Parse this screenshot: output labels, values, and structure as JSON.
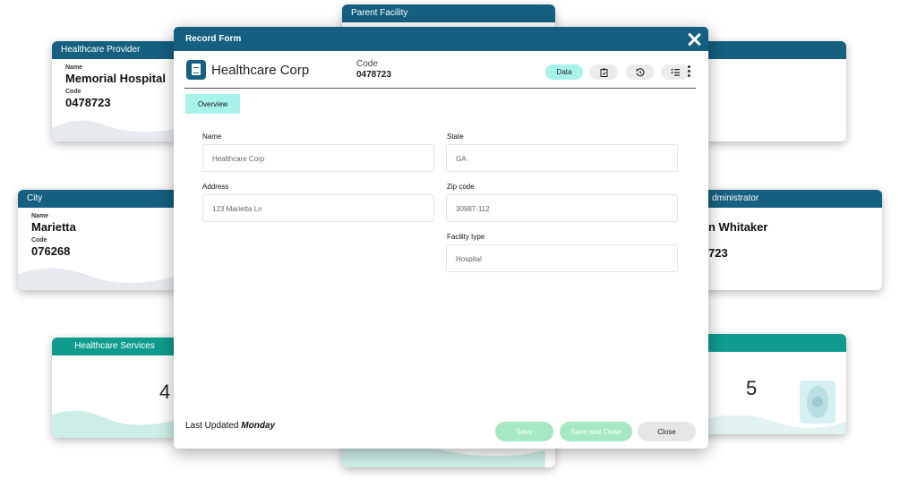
{
  "background": {
    "provider_card": {
      "header": "Healthcare Provider",
      "name_label": "Name",
      "name_value": "Memorial Hospital",
      "code_label": "Code",
      "code_value": "0478723"
    },
    "parent_card": {
      "header": "Parent Facility"
    },
    "city_card": {
      "header": "City",
      "name_label": "Name",
      "name_value": "Marietta",
      "code_label": "Code",
      "code_value": "076268"
    },
    "admin_card": {
      "header": "dministrator",
      "name_value": "n Whitaker",
      "code_value": "723"
    },
    "services_card": {
      "header": "Healthcare Services",
      "count": "4"
    },
    "right_count_card": {
      "count": "5"
    }
  },
  "modal": {
    "title": "Record Form",
    "record_name": "Healthcare Corp",
    "code_label": "Code",
    "code_value": "0478723",
    "toolbar": {
      "data_label": "Data"
    },
    "tabs": [
      {
        "label": "Overview"
      }
    ],
    "fields": {
      "name": {
        "label": "Name",
        "value": "Healthcare Corp"
      },
      "state": {
        "label": "State",
        "value": "GA"
      },
      "address": {
        "label": "Address",
        "value": "123 Marietta Ln"
      },
      "zip": {
        "label": "Zip code",
        "value": "30987-112"
      },
      "facility_type": {
        "label": "Facility type",
        "value": "Hospital"
      }
    },
    "footer": {
      "updated_prefix": "Last Updated",
      "updated_value": "Monday",
      "save_label": "Save",
      "save_close_label": "Save and Close",
      "close_label": "Close"
    }
  },
  "colors": {
    "header": "#155f80",
    "teal": "#0f9c8f",
    "accent": "#a8f2ec",
    "save": "#a6e8c3"
  }
}
